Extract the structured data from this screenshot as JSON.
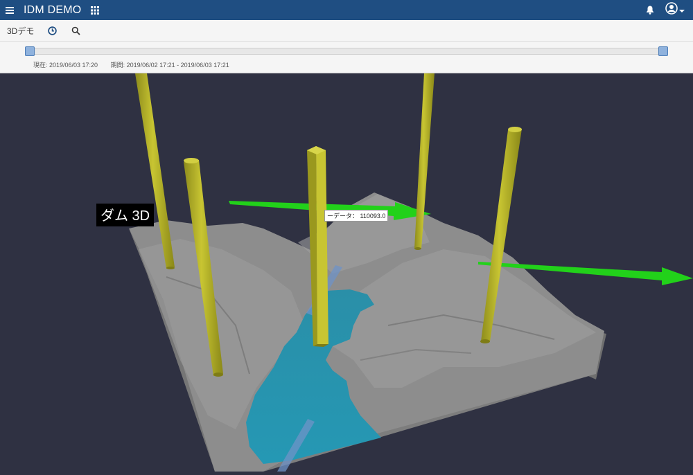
{
  "header": {
    "app_title": "IDM DEMO",
    "menu_icon": "hamburger-menu-icon",
    "apps_icon": "app-grid-icon",
    "bell_icon": "bell-icon",
    "user_icon": "user-circle-icon"
  },
  "toolbar": {
    "page_label": "3Dデモ",
    "history_icon": "clock-icon",
    "search_icon": "search-icon"
  },
  "timeline": {
    "current_label": "現在: 2019/06/03 17:20",
    "period_label": "期間: 2019/06/02 17:21 - 2019/06/03 17:21",
    "range_fraction": [
      0.0,
      1.0
    ]
  },
  "scene": {
    "title_label": "ダム 3D",
    "tooltip_text": "ーデータ： 110093.0",
    "colors": {
      "background": "#2f3142",
      "terrain": "#8d8d8d",
      "water": "#2a8fa8",
      "pillars": "#b8b52a",
      "arrows": "#22d11a"
    }
  }
}
